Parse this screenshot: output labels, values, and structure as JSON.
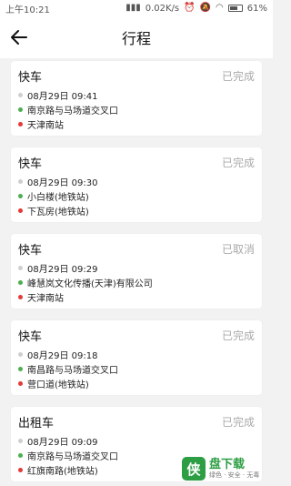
{
  "status_bar": {
    "time": "上午10:21",
    "speed": "0.02K/s",
    "battery": "61%"
  },
  "header": {
    "title": "行程"
  },
  "trips": [
    {
      "type": "快车",
      "status": "已完成",
      "time": "08月29日 09:41",
      "from": "南京路与马场道交叉口",
      "to": "天津南站"
    },
    {
      "type": "快车",
      "status": "已完成",
      "time": "08月29日 09:30",
      "from": "小白楼(地铁站)",
      "to": "下瓦房(地铁站)"
    },
    {
      "type": "快车",
      "status": "已取消",
      "time": "08月29日 09:29",
      "from": "峰慧岚文化传播(天津)有限公司",
      "to": "天津南站"
    },
    {
      "type": "快车",
      "status": "已完成",
      "time": "08月29日 09:18",
      "from": "南昌路与马场道交叉口",
      "to": "营口道(地铁站)"
    },
    {
      "type": "出租车",
      "status": "已完成",
      "time": "08月29日 09:09",
      "from": "南京路与马场道交叉口",
      "to": "红旗南路(地铁站)"
    }
  ],
  "watermark": {
    "logo_char": "侠",
    "name": "盘下载",
    "slogan": "绿色 · 安全 · 无毒"
  },
  "colors": {
    "start_dot": "#4caf50",
    "end_dot": "#e53935",
    "time_dot": "#cfcfcf",
    "status_text": "#aaaaaa",
    "watermark_green": "#2e9e44"
  }
}
